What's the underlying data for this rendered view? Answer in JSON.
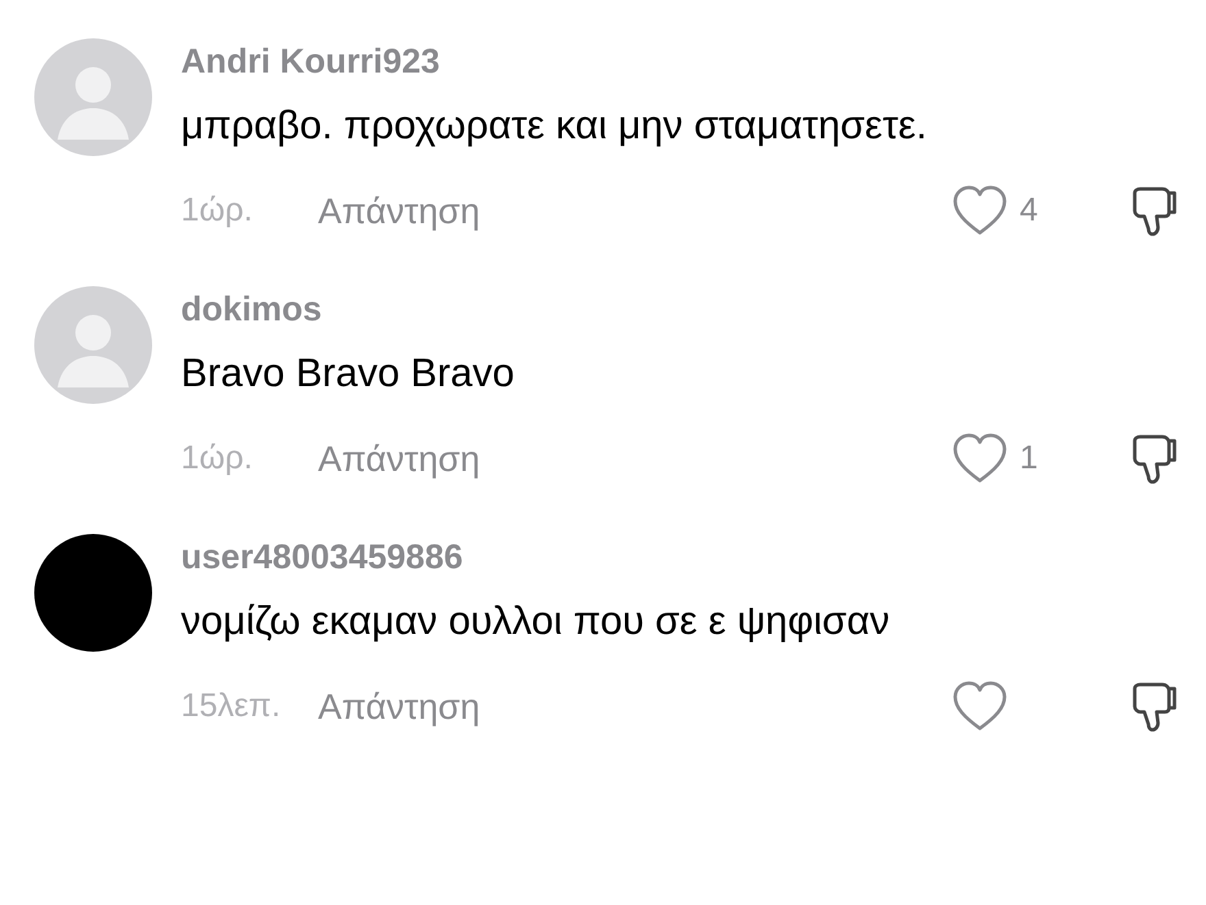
{
  "comments": [
    {
      "avatar": {
        "kind": "silhouette"
      },
      "username": "Andri Kourri923",
      "text": "μπραβο. προχωρατε και μην σταματησετε.",
      "time": "1ώρ.",
      "reply": "Απάντηση",
      "likes": "4"
    },
    {
      "avatar": {
        "kind": "silhouette"
      },
      "username": "dokimos",
      "text": "Bravo Bravo Bravo",
      "time": "1ώρ.",
      "reply": "Απάντηση",
      "likes": "1"
    },
    {
      "avatar": {
        "kind": "dark"
      },
      "username": "user48003459886",
      "text": "νομίζω εκαμαν ουλλοι που σε ε ψηφισαν",
      "time": "15λεπ.",
      "reply": "Απάντηση"
    }
  ]
}
